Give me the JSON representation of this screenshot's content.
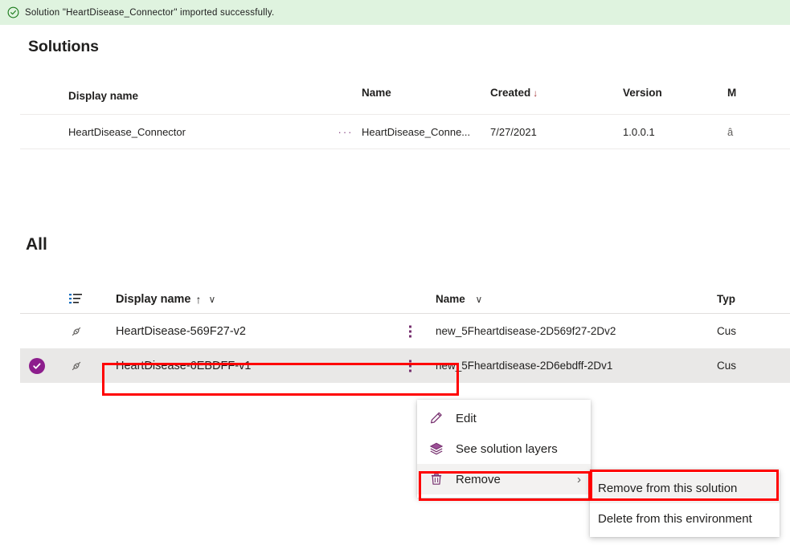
{
  "banner": {
    "icon": "check-circle-icon",
    "message": "Solution \"HeartDisease_Connector\" imported successfully.",
    "background_color": "#dff3df",
    "icon_color": "#107c10"
  },
  "solutions_section": {
    "title": "Solutions",
    "columns": [
      "Display name",
      "Name",
      "Created",
      "Version",
      "M"
    ],
    "sort_column": "Created",
    "sort_direction_glyph": "↓",
    "rows": [
      {
        "display_name": "HeartDisease_Connector",
        "overflow_glyph": "···",
        "name": "HeartDisease_Conne...",
        "created": "7/27/2021",
        "version": "1.0.0.1",
        "managed_glyph": "â"
      }
    ]
  },
  "all_section": {
    "title": "All",
    "columns": {
      "group_icon": "sort-group-icon",
      "display_name": "Display name",
      "display_name_sort_glyph": "↑",
      "display_name_chevron": "∨",
      "name": "Name",
      "name_chevron": "∨",
      "type": "Typ"
    },
    "rows": [
      {
        "selected": false,
        "row_icon": "connector-plug-icon",
        "display_name": "HeartDisease-569F27-v2",
        "overflow_icon": "vertical-ellipsis-icon",
        "name": "new_5Fheartdisease-2D569f27-2Dv2",
        "type": "Cus"
      },
      {
        "selected": true,
        "select_icon": "checkmark-circle-icon",
        "row_icon": "connector-plug-icon",
        "display_name": "HeartDisease-6EBDFF-v1",
        "overflow_icon": "vertical-ellipsis-icon",
        "name": "new_5Fheartdisease-2D6ebdff-2Dv1",
        "type": "Cus"
      }
    ]
  },
  "context_menu": {
    "items": [
      {
        "icon": "pencil-icon",
        "label": "Edit",
        "has_submenu": false
      },
      {
        "icon": "layers-icon",
        "label": "See solution layers",
        "has_submenu": false
      },
      {
        "icon": "trash-icon",
        "label": "Remove",
        "has_submenu": true,
        "submenu_chevron": "›",
        "highlighted": true
      }
    ]
  },
  "submenu": {
    "items": [
      {
        "label": "Remove from this solution",
        "highlighted": true
      },
      {
        "label": "Delete from this environment",
        "highlighted": false
      }
    ]
  },
  "annotations": {
    "highlight_color": "#ff0000",
    "boxes": [
      "selected-row-display-name",
      "remove-menu-item",
      "remove-from-this-solution-item"
    ]
  },
  "theme": {
    "accent_purple": "#8d1e8d",
    "selected_row_bg": "#e9e8e7",
    "menu_hover_bg": "#f3f2f1"
  }
}
